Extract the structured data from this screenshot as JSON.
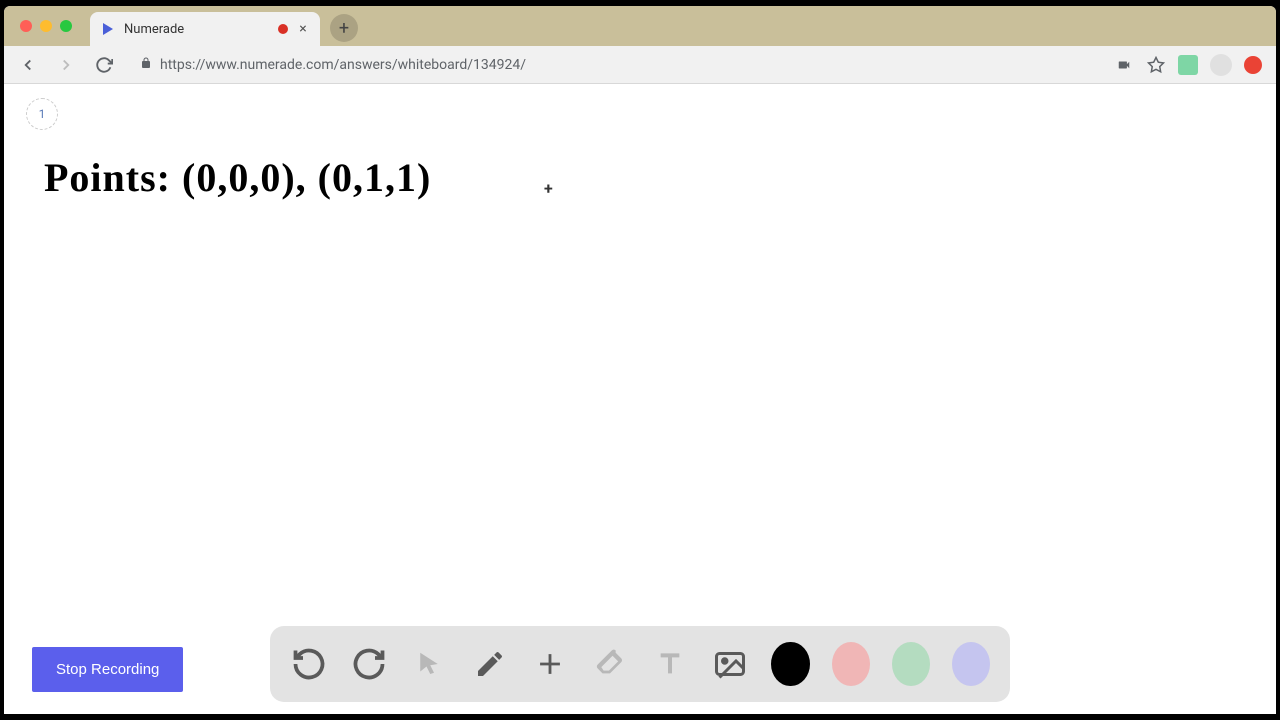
{
  "browser": {
    "tab": {
      "title": "Numerade"
    },
    "url": "https://www.numerade.com/answers/whiteboard/134924/"
  },
  "whiteboard": {
    "page_number": "1",
    "handwriting_text": "Points:   (0,0,0), (0,1,1)",
    "stop_button_label": "Stop Recording"
  },
  "tools": {
    "undo": "undo",
    "redo": "redo",
    "pointer": "pointer",
    "pen": "pen",
    "plus": "plus",
    "eraser": "eraser",
    "text": "text",
    "image": "image"
  },
  "colors": {
    "black": "#000000",
    "pink": "#f0b6b6",
    "green": "#b4dcc0",
    "purple": "#c5c5ef"
  }
}
